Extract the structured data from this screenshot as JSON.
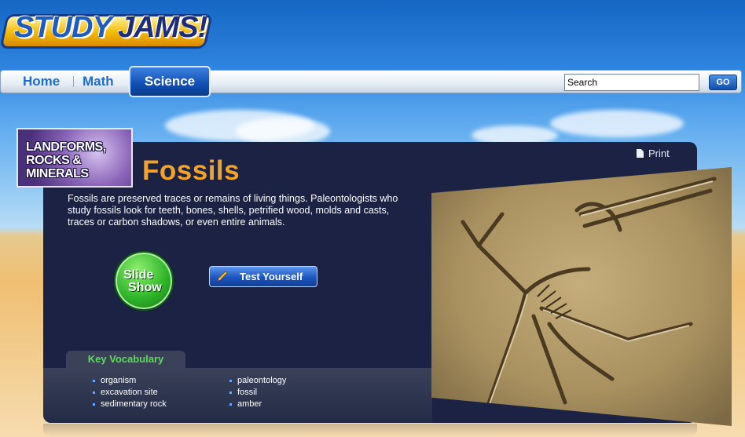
{
  "logo": {
    "part1": "STUDY",
    "part2": "JAMS!"
  },
  "nav": {
    "home": "Home",
    "math": "Math",
    "science": "Science"
  },
  "search": {
    "value": "Search",
    "go": "GO"
  },
  "badge": {
    "line1": "LANDFORMS,",
    "line2": "ROCKS &",
    "line3": "MINERALS"
  },
  "page": {
    "title": "Fossils",
    "print": "Print",
    "description": "Fossils are preserved traces or remains of living things. Paleontologists who study fossils look for teeth, bones, shells, petrified wood, molds and casts, traces or carbon shadows, or even entire animals."
  },
  "buttons": {
    "slide_line1": "Slide",
    "slide_line2": "Show",
    "test": "Test Yourself"
  },
  "vocab": {
    "title": "Key Vocabulary",
    "col1": [
      "organism",
      "excavation site",
      "sedimentary rock"
    ],
    "col2": [
      "paleontology",
      "fossil",
      "amber"
    ]
  },
  "colors": {
    "title": "#f4a32a",
    "panel": "#1b2243",
    "vocab_title": "#5fdc5a"
  }
}
